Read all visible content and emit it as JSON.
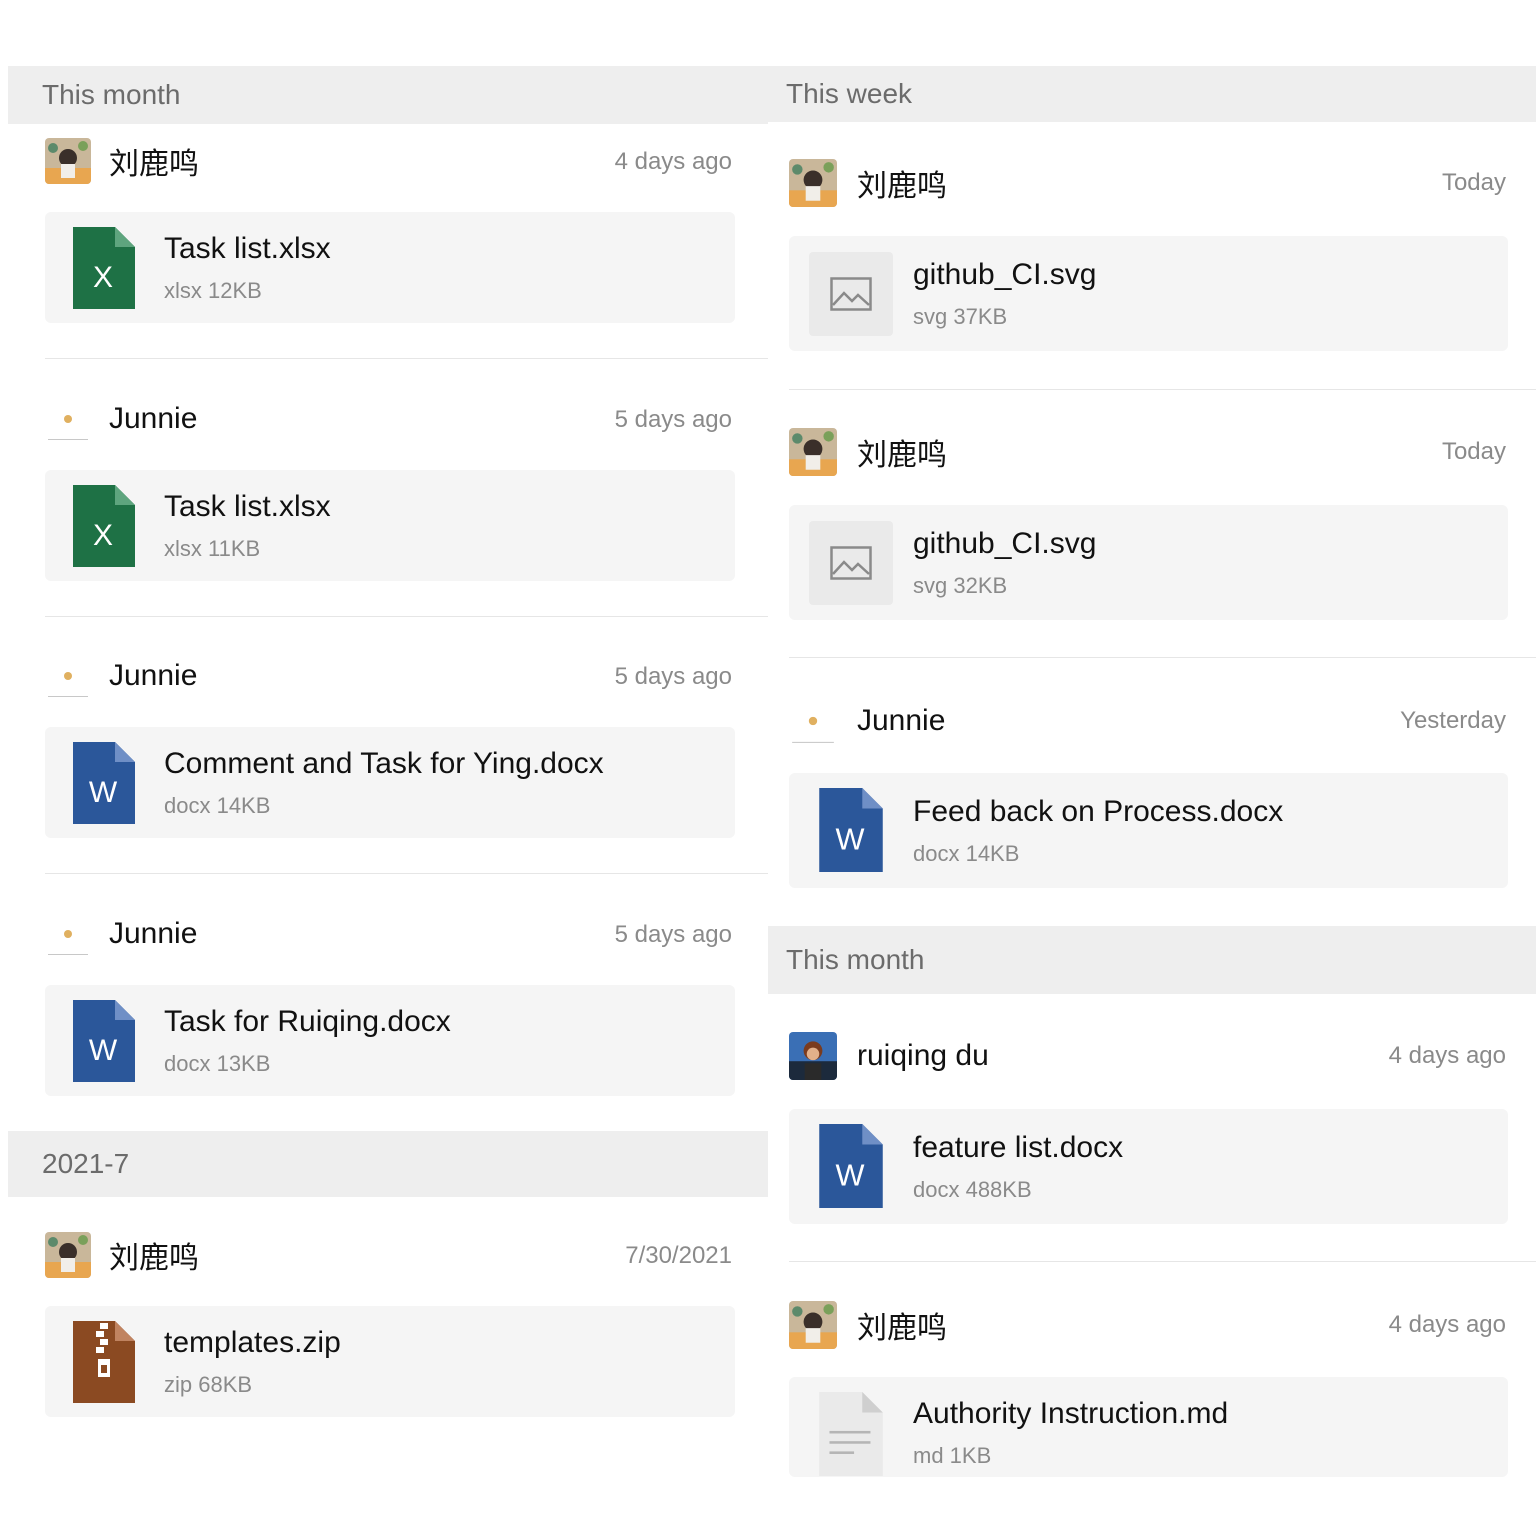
{
  "left": {
    "section_month": "This month",
    "section_2021": "2021-7",
    "entries": [
      {
        "user": "刘鹿鸣",
        "time": "4 days ago",
        "file": "Task list.xlsx",
        "meta": "xlsx 12KB",
        "type": "xlsx"
      },
      {
        "user": "Junnie",
        "time": "5 days ago",
        "file": "Task list.xlsx",
        "meta": "xlsx 11KB",
        "type": "xlsx"
      },
      {
        "user": "Junnie",
        "time": "5 days ago",
        "file": "Comment and Task for Ying.docx",
        "meta": "docx 14KB",
        "type": "docx"
      },
      {
        "user": "Junnie",
        "time": "5 days ago",
        "file": "Task for Ruiqing.docx",
        "meta": "docx 13KB",
        "type": "docx"
      },
      {
        "user": "刘鹿鸣",
        "time": "7/30/2021",
        "file": "templates.zip",
        "meta": "zip 68KB",
        "type": "zip"
      }
    ]
  },
  "right": {
    "section_week": "This week",
    "section_month": "This month",
    "entries": [
      {
        "user": "刘鹿鸣",
        "time": "Today",
        "file": "github_CI.svg",
        "meta": "svg 37KB",
        "type": "svg"
      },
      {
        "user": "刘鹿鸣",
        "time": "Today",
        "file": "github_CI.svg",
        "meta": "svg 32KB",
        "type": "svg"
      },
      {
        "user": "Junnie",
        "time": "Yesterday",
        "file": "Feed back on Process.docx",
        "meta": "docx 14KB",
        "type": "docx"
      },
      {
        "user": "ruiqing du",
        "time": "4 days ago",
        "file": "feature list.docx",
        "meta": "docx 488KB",
        "type": "docx"
      },
      {
        "user": "刘鹿鸣",
        "time": "4 days ago",
        "file": "Authority Instruction.md",
        "meta": "md 1KB",
        "type": "md"
      }
    ]
  },
  "icon_glyphs": {
    "xlsx": "X",
    "docx": "W"
  },
  "colors": {
    "xlsx": "#1e7145",
    "docx": "#2b579a",
    "zip": "#8b4a22",
    "section_bg": "#eeeeee",
    "card_bg": "#f5f5f5"
  }
}
